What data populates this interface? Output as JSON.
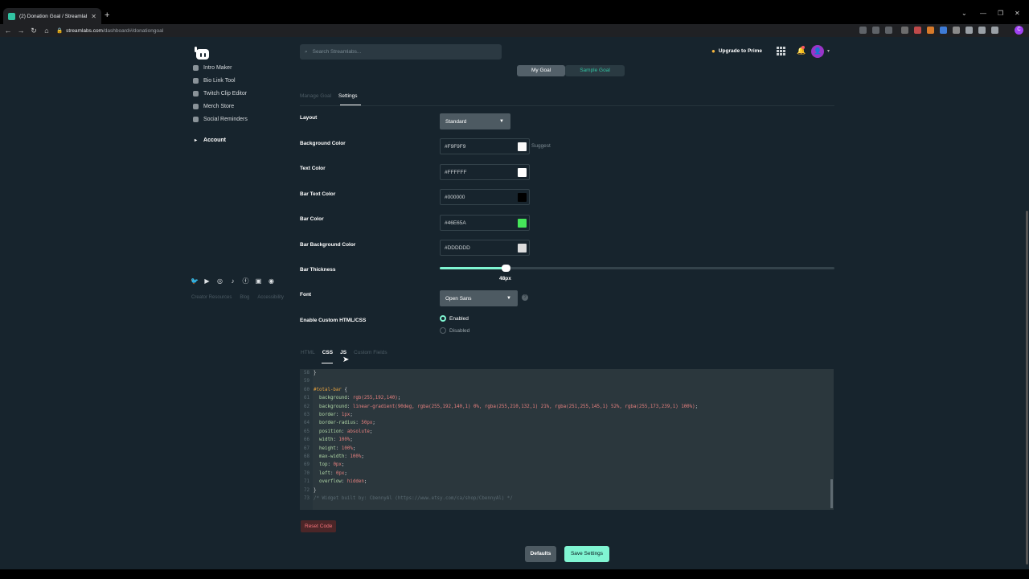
{
  "browser": {
    "tab_title": "(2) Donation Goal / Streamlabs",
    "new_tab": "+",
    "url_host": "streamlabs.com",
    "url_path": "/dashboard#/donationgoal",
    "profile_initial": "C",
    "win_min": "—",
    "win_max": "❐",
    "win_close": "✕",
    "tab_list": "⌄"
  },
  "sidebar": {
    "items": [
      {
        "label": "Intro Maker",
        "icon": "film-icon"
      },
      {
        "label": "Bio Link Tool",
        "icon": "link-icon"
      },
      {
        "label": "Twitch Clip Editor",
        "icon": "clip-icon"
      },
      {
        "label": "Merch Store",
        "icon": "shirt-icon"
      },
      {
        "label": "Social Reminders",
        "icon": "thumbs-up-icon"
      }
    ],
    "account": "Account",
    "social_icons": [
      "twitter-icon",
      "youtube-icon",
      "instagram-icon",
      "tiktok-icon",
      "facebook-icon",
      "linkedin-icon",
      "discord-icon"
    ],
    "footer_links": [
      "Creator Resources",
      "Blog",
      "Accessibility"
    ]
  },
  "header": {
    "search_placeholder": "Search Streamlabs...",
    "upgrade": "Upgrade to Prime"
  },
  "goal_toggle": {
    "my": "My Goal",
    "sample": "Sample Goal"
  },
  "tabs": {
    "manage": "Manage Goal",
    "settings": "Settings"
  },
  "form": {
    "layout": {
      "label": "Layout",
      "value": "Standard"
    },
    "background_color": {
      "label": "Background Color",
      "value": "#F9F9F9",
      "swatch": "#F9F9F9",
      "suggest": "Suggest"
    },
    "text_color": {
      "label": "Text Color",
      "value": "#FFFFFF",
      "swatch": "#FFFFFF"
    },
    "bar_text_color": {
      "label": "Bar Text Color",
      "value": "#000000",
      "swatch": "#000000"
    },
    "bar_color": {
      "label": "Bar Color",
      "value": "#46E65A",
      "swatch": "#46E65A"
    },
    "bar_bg_color": {
      "label": "Bar Background Color",
      "value": "#DDDDDD",
      "swatch": "#DDDDDD"
    },
    "bar_thickness": {
      "label": "Bar Thickness",
      "value": "48px"
    },
    "font": {
      "label": "Font",
      "value": "Open Sans"
    },
    "custom_html": {
      "label": "Enable Custom HTML/CSS",
      "enabled": "Enabled",
      "disabled": "Disabled"
    }
  },
  "code_tabs": {
    "html": "HTML",
    "css": "CSS",
    "js": "JS",
    "custom_fields": "Custom Fields"
  },
  "editor": {
    "line_numbers": [
      "58",
      "59",
      "60",
      "61",
      "62",
      "63",
      "64",
      "65",
      "66",
      "67",
      "68",
      "69",
      "70",
      "71",
      "72",
      "73"
    ],
    "lines": [
      [
        {
          "t": "}",
          "c": ""
        }
      ],
      [
        {
          "t": "",
          "c": ""
        }
      ],
      [
        {
          "t": "#total-bar",
          "c": "sel"
        },
        {
          "t": " {",
          "c": ""
        }
      ],
      [
        {
          "t": "  background",
          "c": "prop"
        },
        {
          "t": ": ",
          "c": ""
        },
        {
          "t": "rgb(255,192,140)",
          "c": "val"
        },
        {
          "t": ";",
          "c": ""
        }
      ],
      [
        {
          "t": "  background",
          "c": "prop"
        },
        {
          "t": ": ",
          "c": ""
        },
        {
          "t": "linear-gradient(90deg, rgba(255,192,140,1) 0%, rgba(255,210,132,1) 21%, rgba(251,255,145,1) 52%, rgba(255,173,239,1) 100%)",
          "c": "val"
        },
        {
          "t": ";",
          "c": ""
        }
      ],
      [
        {
          "t": "  border",
          "c": "prop"
        },
        {
          "t": ": ",
          "c": ""
        },
        {
          "t": "1px",
          "c": "val"
        },
        {
          "t": ";",
          "c": ""
        }
      ],
      [
        {
          "t": "  border-radius",
          "c": "prop"
        },
        {
          "t": ": ",
          "c": ""
        },
        {
          "t": "50px",
          "c": "val"
        },
        {
          "t": ";",
          "c": ""
        }
      ],
      [
        {
          "t": "  position",
          "c": "prop"
        },
        {
          "t": ": ",
          "c": ""
        },
        {
          "t": "absolute",
          "c": "val"
        },
        {
          "t": ";",
          "c": ""
        }
      ],
      [
        {
          "t": "  width",
          "c": "prop"
        },
        {
          "t": ": ",
          "c": ""
        },
        {
          "t": "100%",
          "c": "val"
        },
        {
          "t": ";",
          "c": ""
        }
      ],
      [
        {
          "t": "  height",
          "c": "prop"
        },
        {
          "t": ": ",
          "c": ""
        },
        {
          "t": "100%",
          "c": "val"
        },
        {
          "t": ";",
          "c": ""
        }
      ],
      [
        {
          "t": "  max-width",
          "c": "prop"
        },
        {
          "t": ": ",
          "c": ""
        },
        {
          "t": "100%",
          "c": "val"
        },
        {
          "t": ";",
          "c": ""
        }
      ],
      [
        {
          "t": "  top",
          "c": "prop"
        },
        {
          "t": ": ",
          "c": ""
        },
        {
          "t": "0px",
          "c": "val"
        },
        {
          "t": ";",
          "c": ""
        }
      ],
      [
        {
          "t": "  left",
          "c": "prop"
        },
        {
          "t": ": ",
          "c": ""
        },
        {
          "t": "0px",
          "c": "val"
        },
        {
          "t": ";",
          "c": ""
        }
      ],
      [
        {
          "t": "  overflow",
          "c": "prop"
        },
        {
          "t": ": ",
          "c": ""
        },
        {
          "t": "hidden",
          "c": "val"
        },
        {
          "t": ";",
          "c": ""
        }
      ],
      [
        {
          "t": "}",
          "c": ""
        }
      ],
      [
        {
          "t": "/* Widget built by: CbennyAl (https://www.etsy.com/ca/shop/CbennyAl) */",
          "c": "cm"
        }
      ]
    ]
  },
  "buttons": {
    "reset": "Reset Code",
    "defaults": "Defaults",
    "save": "Save Settings"
  }
}
